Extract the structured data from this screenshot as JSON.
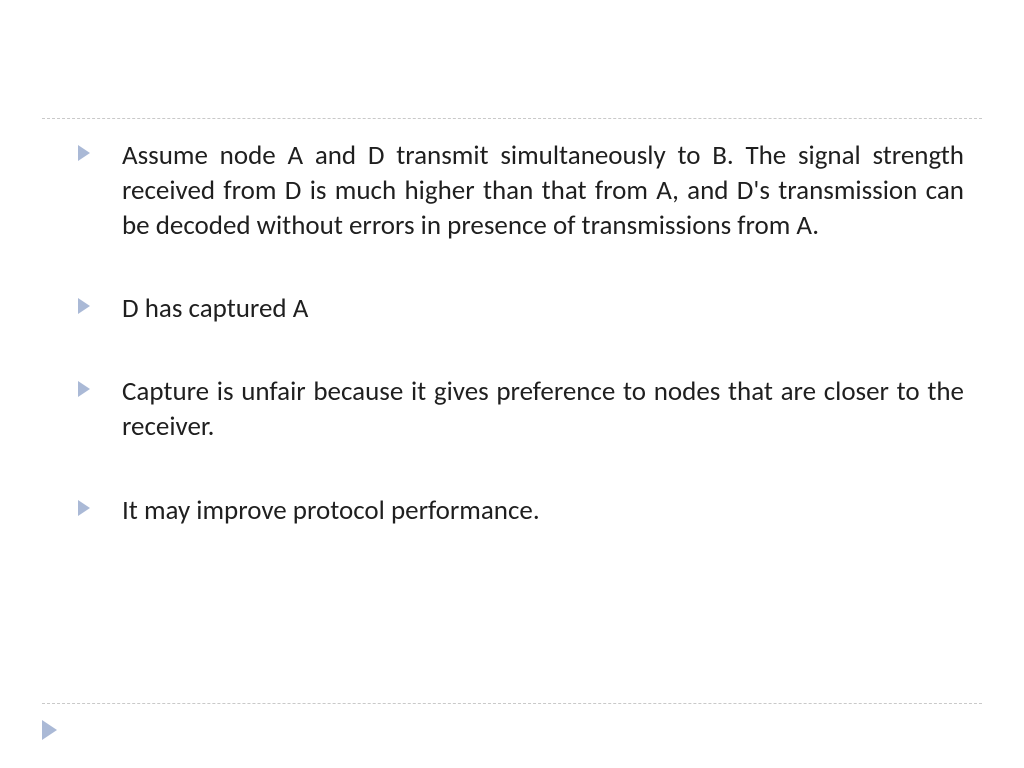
{
  "bullets": [
    {
      "text": "Assume node A and D transmit simultaneously to B. The signal strength received from D is much higher than that from A, and D's transmission can be decoded without errors in presence of transmissions from A."
    },
    {
      "text": "D has captured A"
    },
    {
      "text": "Capture is unfair because it gives preference to nodes that are closer to the receiver."
    },
    {
      "text": "It may improve protocol performance."
    }
  ]
}
